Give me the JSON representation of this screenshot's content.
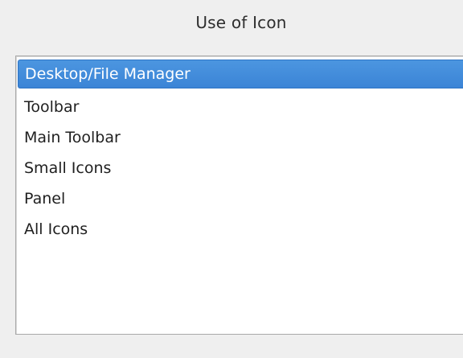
{
  "dialog": {
    "title": "Use of Icon"
  },
  "icon_use_list": {
    "selected_index": 0,
    "items": [
      {
        "label": "Desktop/File Manager"
      },
      {
        "label": "Toolbar"
      },
      {
        "label": "Main Toolbar"
      },
      {
        "label": "Small Icons"
      },
      {
        "label": "Panel"
      },
      {
        "label": "All Icons"
      }
    ]
  },
  "colors": {
    "background": "#efefef",
    "list_background": "#ffffff",
    "selection": "#3b84d6",
    "text": "#1f1f1f"
  }
}
